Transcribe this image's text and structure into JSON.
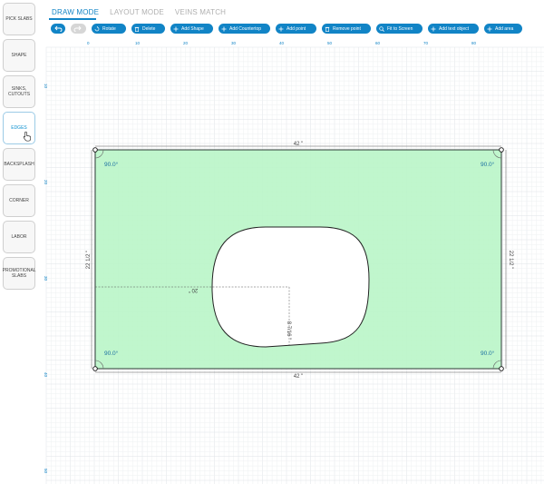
{
  "sidebar": {
    "items": [
      {
        "label": "PICK SLABS"
      },
      {
        "label": "SHAPE"
      },
      {
        "label": "SINKS, CUTOUTS"
      },
      {
        "label": "EDGES"
      },
      {
        "label": "BACKSPLASH"
      },
      {
        "label": "CORNER"
      },
      {
        "label": "LABOR"
      },
      {
        "label": "PROMOTIONAL SLABS"
      }
    ],
    "active_index": 3
  },
  "tabs": [
    {
      "label": "DRAW MODE"
    },
    {
      "label": "LAYOUT MODE"
    },
    {
      "label": "VEINS MATCH"
    }
  ],
  "toolbar": {
    "rotate": "Rotate",
    "delete": "Delete",
    "add_shape": "Add Shape",
    "add_countertop": "Add Countertop",
    "add_point": "Add point",
    "remove_point": "Remove point",
    "fit_to_screen": "Fit to Screen",
    "add_text_object": "Add text object",
    "add_area": "Add area"
  },
  "ruler": {
    "top_ticks": [
      "0",
      "10",
      "20",
      "30",
      "40",
      "50",
      "60",
      "70",
      "80"
    ],
    "left_ticks": [
      "10",
      "20",
      "30",
      "40",
      "50"
    ]
  },
  "drawing": {
    "top_dimension": "42 \"",
    "bottom_dimension": "42 \"",
    "left_dimension": "22 1/2 \"",
    "right_dimension": "22 1/2 \"",
    "corner_angles": [
      "90.0°",
      "90.0°",
      "90.0°",
      "90.0°"
    ],
    "cutout_horizontal": "20 \"",
    "cutout_vertical": "8 7/16 \""
  },
  "colors": {
    "accent": "#1184c6",
    "countertop_fill": "#b9f5c8",
    "grid_minor": "#eef0f2",
    "grid_major": "#dfe3e7"
  }
}
